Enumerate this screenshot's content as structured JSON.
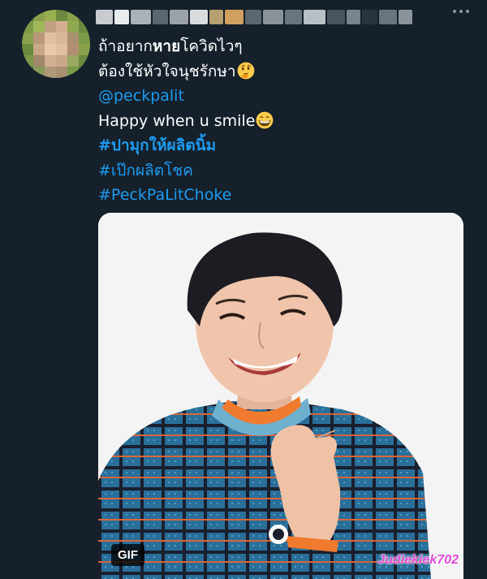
{
  "tweet": {
    "lines": [
      {
        "before": "ถ้าอยาก",
        "bold": "หาย",
        "after": "โควิดไวๆ"
      },
      {
        "text": "ต้องใช้หัวใจนุชรักษา"
      },
      {
        "mention": "@peckpalit"
      },
      {
        "text": "Happy when u smile"
      },
      {
        "hashtag1": "#ปามุกให้ผลิตนิ้ม"
      },
      {
        "hashtag2": "#เป๊กผลิตโชค"
      },
      {
        "hashtag3": "#PeckPaLitChoke"
      }
    ],
    "emojis": [
      "thinking-face",
      "grinning-face"
    ]
  },
  "media": {
    "badge": "GIF",
    "watermark": "Judiekiek702"
  },
  "colors": {
    "background": "#15202b",
    "link": "#1d9bf0",
    "text": "#ffffff",
    "watermark": "#e04bd8"
  }
}
